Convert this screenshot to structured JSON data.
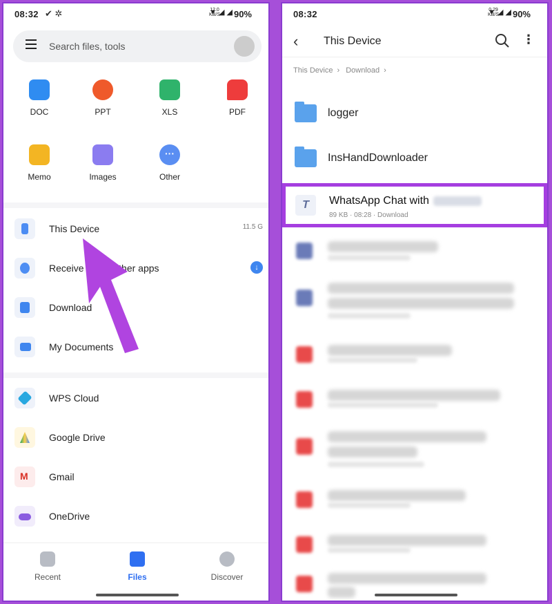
{
  "left": {
    "status": {
      "time": "08:32",
      "net": "12.0\nKB/S",
      "battery": "90%"
    },
    "search": {
      "placeholder": "Search files, tools"
    },
    "tiles": [
      {
        "label": "DOC",
        "color": "#2f8cf1"
      },
      {
        "label": "PPT",
        "color": "#ef5a2b"
      },
      {
        "label": "XLS",
        "color": "#2fb36b"
      },
      {
        "label": "PDF",
        "color": "#ee3c3c"
      },
      {
        "label": "Memo",
        "color": "#f3b523"
      },
      {
        "label": "Images",
        "color": "#8b7cf0"
      },
      {
        "label": "Other",
        "color": "#5a8ef2"
      }
    ],
    "locations": [
      {
        "label": "This Device",
        "right": "11.5 G"
      },
      {
        "label": "Receive             ther apps"
      },
      {
        "label": "Download"
      },
      {
        "label": "My Documents"
      }
    ],
    "cloud": [
      {
        "label": "WPS Cloud"
      },
      {
        "label": "Google Drive"
      },
      {
        "label": "Gmail"
      },
      {
        "label": "OneDrive"
      }
    ],
    "nav": {
      "recent": "Recent",
      "files": "Files",
      "discover": "Discover"
    }
  },
  "right": {
    "status": {
      "time": "08:32",
      "net": "0.29\nKB/S",
      "battery": "90%"
    },
    "title": "This Device",
    "breadcrumb": [
      "This Device",
      "Download"
    ],
    "folders": [
      "logger",
      "InsHandDownloader"
    ],
    "highlighted_file": {
      "name": "WhatsApp Chat with",
      "meta": "89 KB · 08:28 · Download"
    }
  }
}
